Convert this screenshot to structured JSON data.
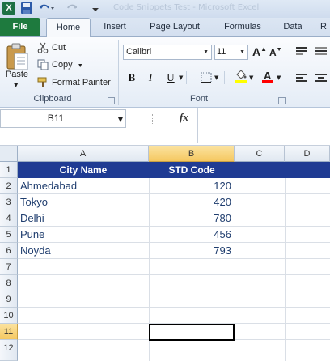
{
  "title_bar": {
    "logo_glyph": "X",
    "faded_title": "Code Snippets Test - Microsoft Excel"
  },
  "tabs": [
    {
      "label": "File"
    },
    {
      "label": "Home"
    },
    {
      "label": "Insert"
    },
    {
      "label": "Page Layout"
    },
    {
      "label": "Formulas"
    },
    {
      "label": "Data"
    },
    {
      "label": "R"
    }
  ],
  "clipboard": {
    "paste": "Paste",
    "cut": "Cut",
    "copy": "Copy",
    "format_painter": "Format Painter",
    "group_label": "Clipboard"
  },
  "font": {
    "name": "Calibri",
    "size": "11",
    "bold": "B",
    "italic": "I",
    "underline": "U",
    "grow": "A",
    "shrink": "A",
    "group_label": "Font",
    "fill_color": "#ffff00",
    "font_color": "#ff0000"
  },
  "formula_bar": {
    "name_box": "B11",
    "fx": "fx",
    "value": ""
  },
  "grid": {
    "columns": [
      "A",
      "B",
      "C",
      "D"
    ],
    "selected_column": "B",
    "rows": [
      "1",
      "2",
      "3",
      "4",
      "5",
      "6",
      "7",
      "8",
      "9",
      "10",
      "11",
      "12"
    ],
    "selected_row": "11",
    "header_fill": "#1f3b93",
    "cells": {
      "A1": "City Name",
      "B1": "STD Code",
      "A2": "Ahmedabad",
      "B2": "120",
      "A3": "Tokyo",
      "B3": "420",
      "A4": "Delhi",
      "B4": "780",
      "A5": "Pune",
      "B5": "456",
      "A6": "Noyda",
      "B6": "793"
    }
  }
}
